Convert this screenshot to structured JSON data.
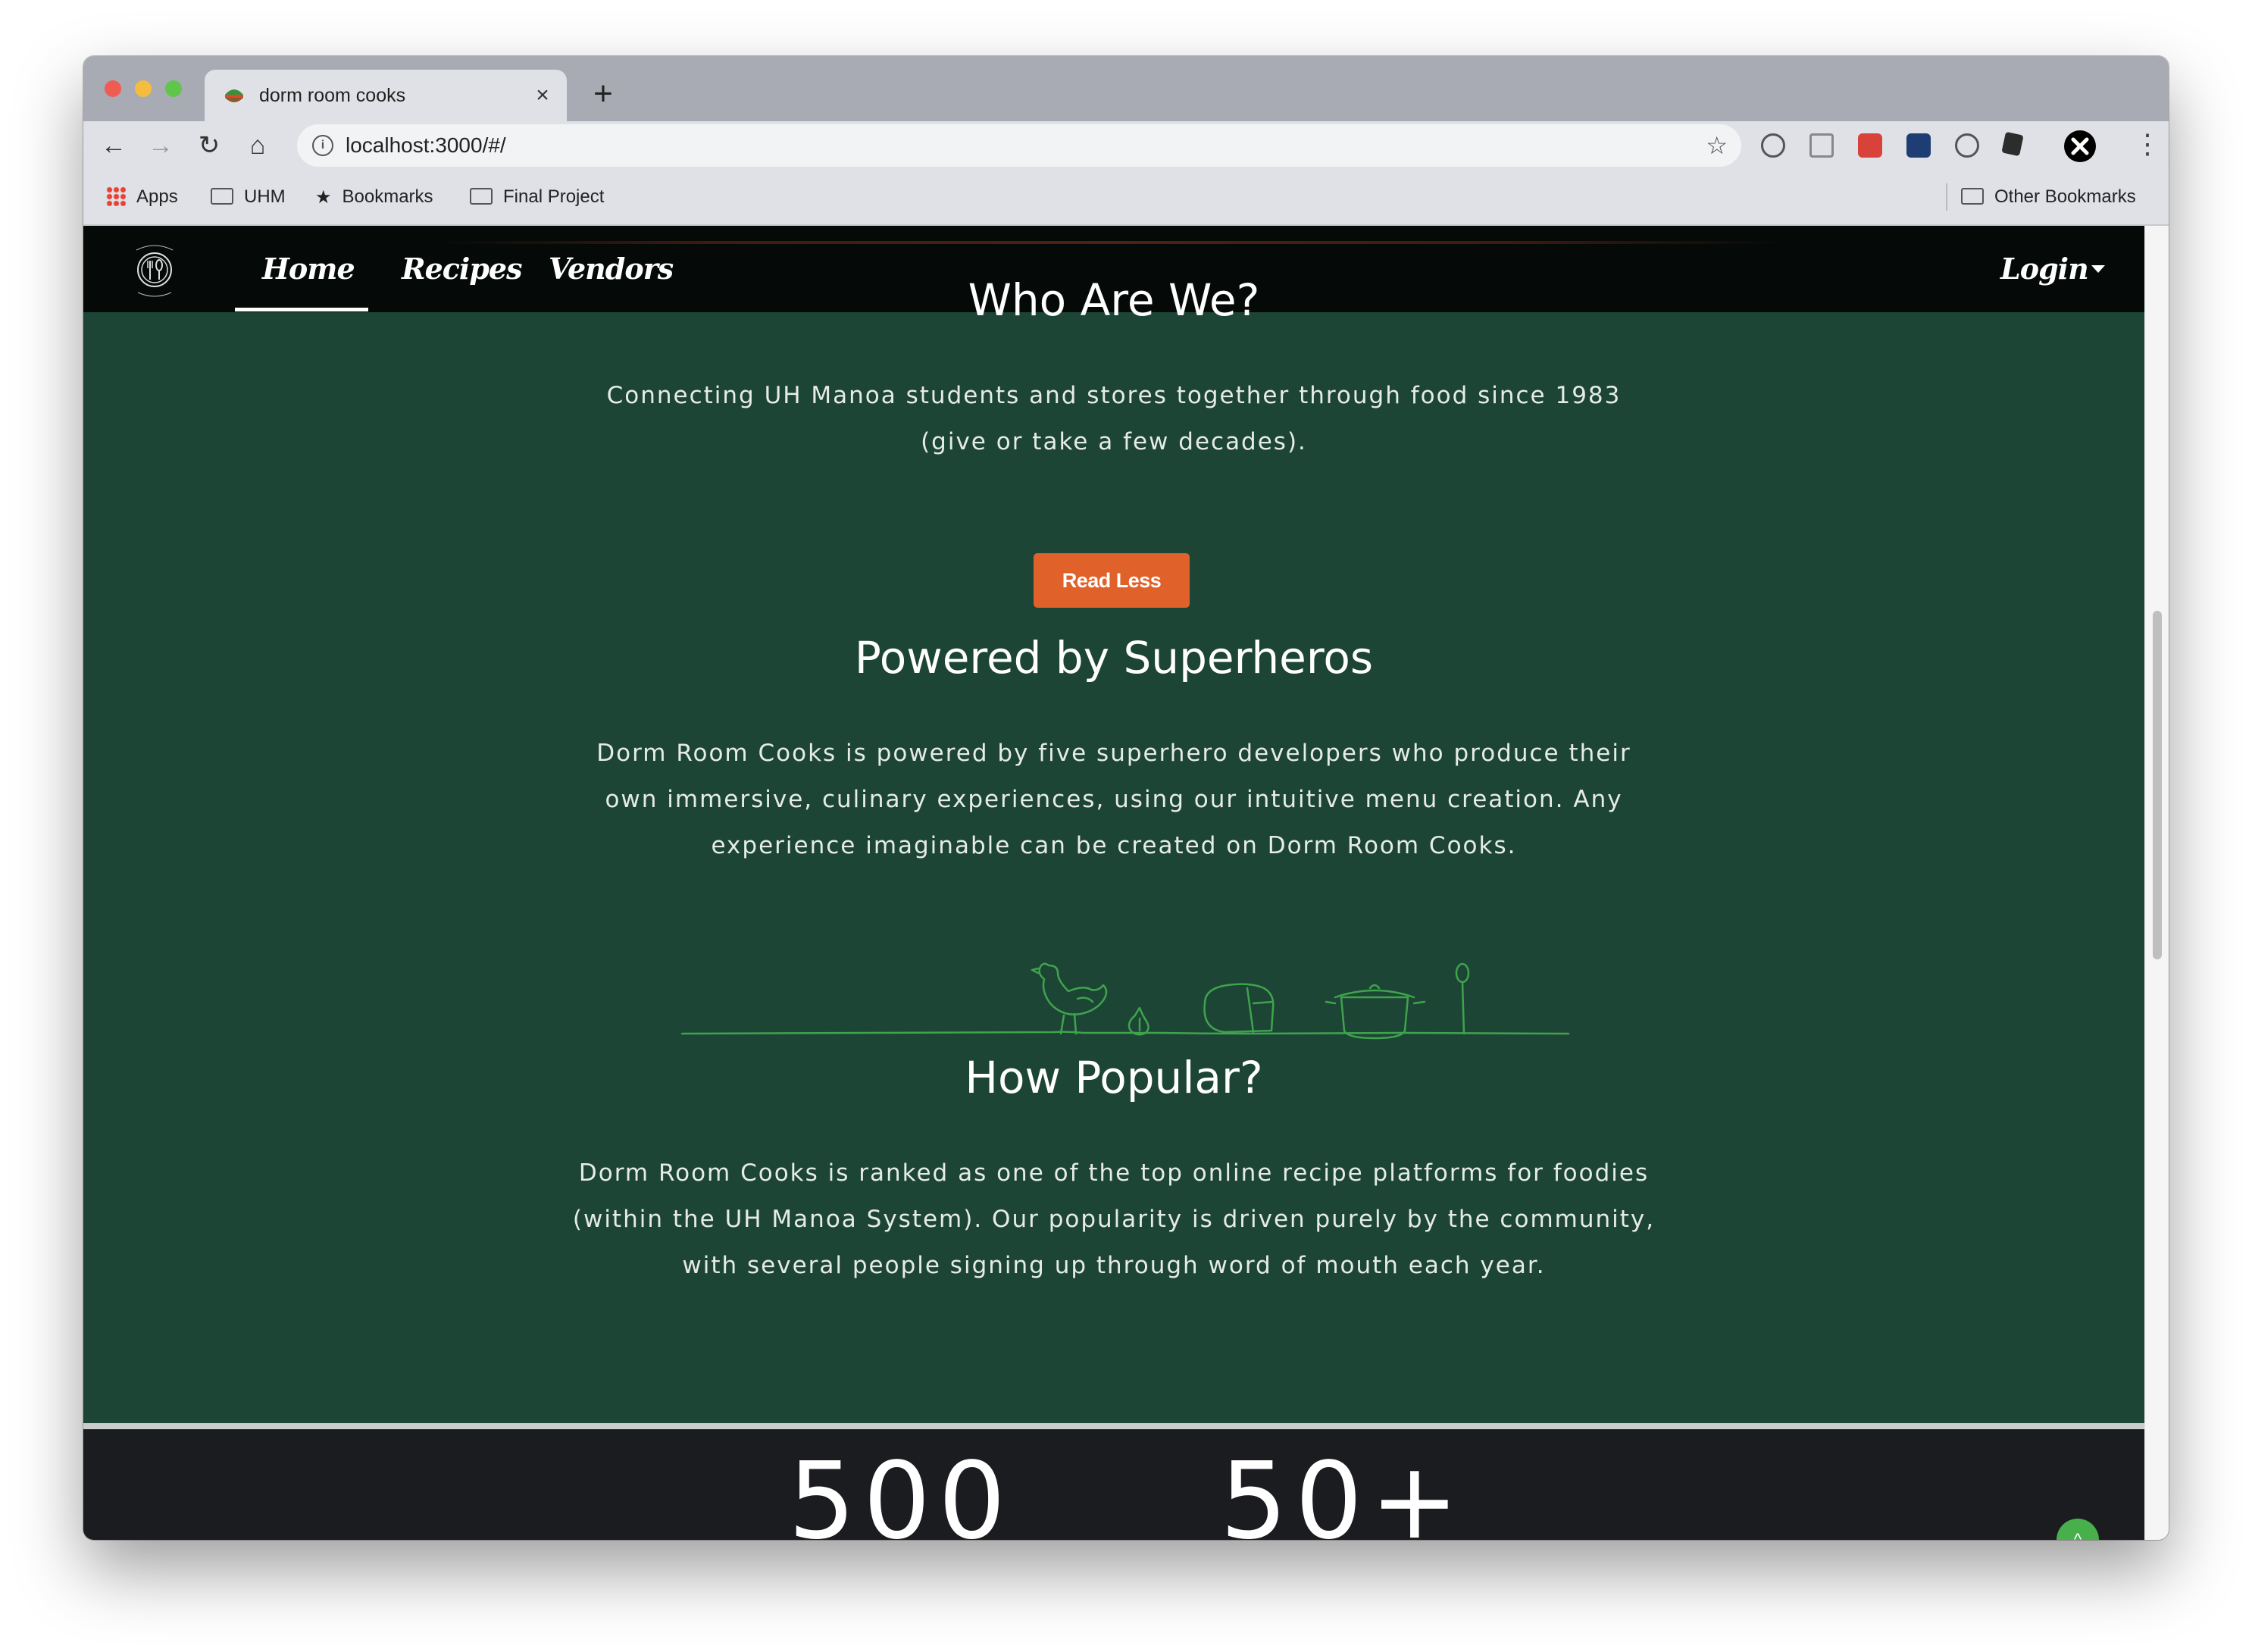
{
  "browser": {
    "tab_title": "dorm room cooks",
    "tab_close": "×",
    "new_tab": "+",
    "url": "localhost:3000/#/",
    "nav": {
      "back": "←",
      "forward": "→",
      "reload": "↻",
      "home": "⌂",
      "star": "☆",
      "menu": "⋮",
      "info": "i"
    },
    "bookmarks": [
      "Apps",
      "UHM",
      "Bookmarks",
      "Final Project"
    ],
    "other_bookmarks": "Other Bookmarks"
  },
  "site": {
    "nav": {
      "home": "Home",
      "recipes": "Recipes",
      "vendors": "Vendors",
      "login": "Login"
    },
    "about": {
      "title": "Who Are We?",
      "line1": "Connecting UH Manoa students and stores together through food since 1983",
      "line2": "(give or take a few decades).",
      "button": "Read Less"
    },
    "powered": {
      "title": "Powered by Superheros",
      "line1": "Dorm Room Cooks is powered by five superhero developers who produce their",
      "line2": "own immersive, culinary experiences, using our intuitive menu creation. Any",
      "line3": "experience imaginable can be created on Dorm Room Cooks."
    },
    "popular": {
      "title": "How Popular?",
      "line1": "Dorm Room Cooks is ranked as one of the top online recipe platforms for foodies",
      "line2": "(within the UH Manoa System). Our popularity is driven purely by the community,",
      "line3": "with several people signing up through word of mouth each year."
    },
    "stats": [
      "500",
      "50+"
    ],
    "scroll_top_icon": "^"
  },
  "colors": {
    "page_green": "#1c4535",
    "navbar_black": "#050a08",
    "button_orange": "#e0622a",
    "sketch_green": "#3fa34d",
    "scroll_top_green": "#47b04b",
    "dark_section": "#1b1c1f"
  }
}
